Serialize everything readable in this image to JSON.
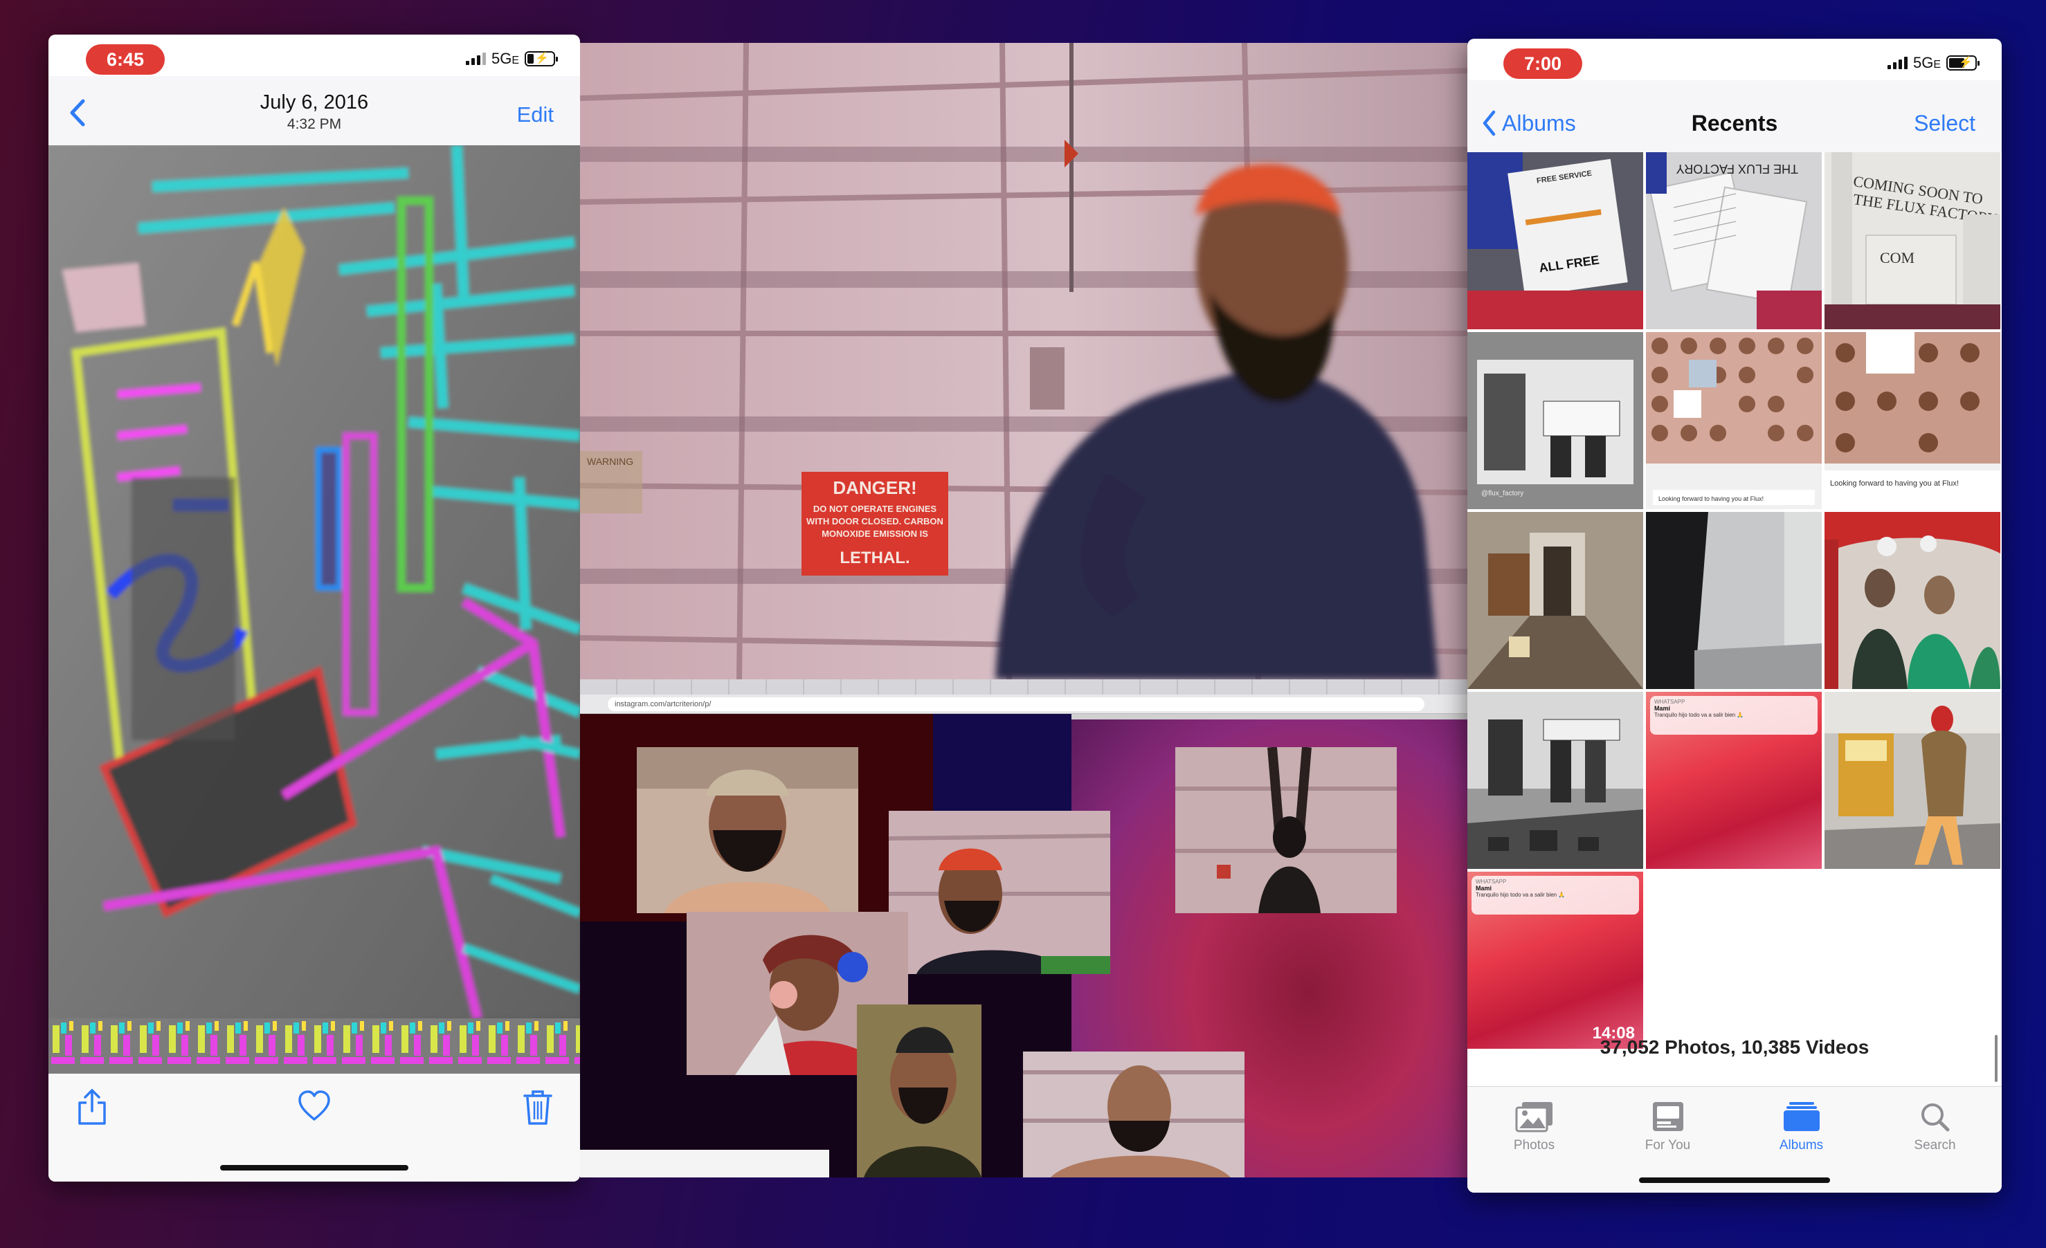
{
  "left_phone": {
    "status": {
      "time": "6:45",
      "network": "5G",
      "network_suffix": "E"
    },
    "header": {
      "back_label": "",
      "date": "July 6, 2016",
      "time": "4:32 PM",
      "edit_label": "Edit"
    },
    "toolbar": {
      "share": "share-icon",
      "favorite": "heart-icon",
      "delete": "trash-icon"
    }
  },
  "center_panel": {
    "sign_text": "DANGER!\nDO NOT OPERATE ENGINES\nWITH DOOR CLOSED. CARBON\nMONOXIDE EMISSION IS\nLETHAL.",
    "warning_label": "WARNING",
    "browser_url": "instagram.com/artcriterion/p/"
  },
  "right_phone": {
    "status": {
      "time": "7:00",
      "network": "5G",
      "network_suffix": "E"
    },
    "header": {
      "back_label": "Albums",
      "title": "Recents",
      "select_label": "Select"
    },
    "tiles": [
      {
        "kind": "flyer",
        "text": "ALL FREE",
        "small_text": "FREE SERVICE"
      },
      {
        "kind": "flyer-stack",
        "text": "THE FLUX FACTORY"
      },
      {
        "kind": "sign",
        "text": "COMING SOON TO THE FLUX FACTORY"
      },
      {
        "kind": "bw-photo",
        "text": "@flux_factory"
      },
      {
        "kind": "grid-screenshot",
        "text": "Looking forward to having you at Flux!"
      },
      {
        "kind": "grid-screenshot",
        "text": "Looking forward to having you at Flux!"
      },
      {
        "kind": "hallway",
        "text": ""
      },
      {
        "kind": "dark-room",
        "text": ""
      },
      {
        "kind": "street-people",
        "text": ""
      },
      {
        "kind": "bw-crowd",
        "text": ""
      },
      {
        "kind": "notification",
        "app": "WHATSAPP",
        "sender": "Mami",
        "message": "Tranquilo hijo todo va a salir bien 🙏"
      },
      {
        "kind": "street-walk",
        "text": ""
      },
      {
        "kind": "notification-video",
        "app": "WHATSAPP",
        "sender": "Mami",
        "message": "Tranquilo hijo todo va a salir bien 🙏",
        "duration": "14:08"
      }
    ],
    "count": "37,052 Photos, 10,385 Videos",
    "tabs": [
      {
        "label": "Photos",
        "icon": "photos-icon",
        "active": false
      },
      {
        "label": "For You",
        "icon": "for-you-icon",
        "active": false
      },
      {
        "label": "Albums",
        "icon": "albums-icon",
        "active": true
      },
      {
        "label": "Search",
        "icon": "search-icon",
        "active": false
      }
    ]
  },
  "colors": {
    "accent": "#2f7bf5",
    "status_pill": "#e13b35",
    "tab_inactive": "#8e8e93"
  }
}
